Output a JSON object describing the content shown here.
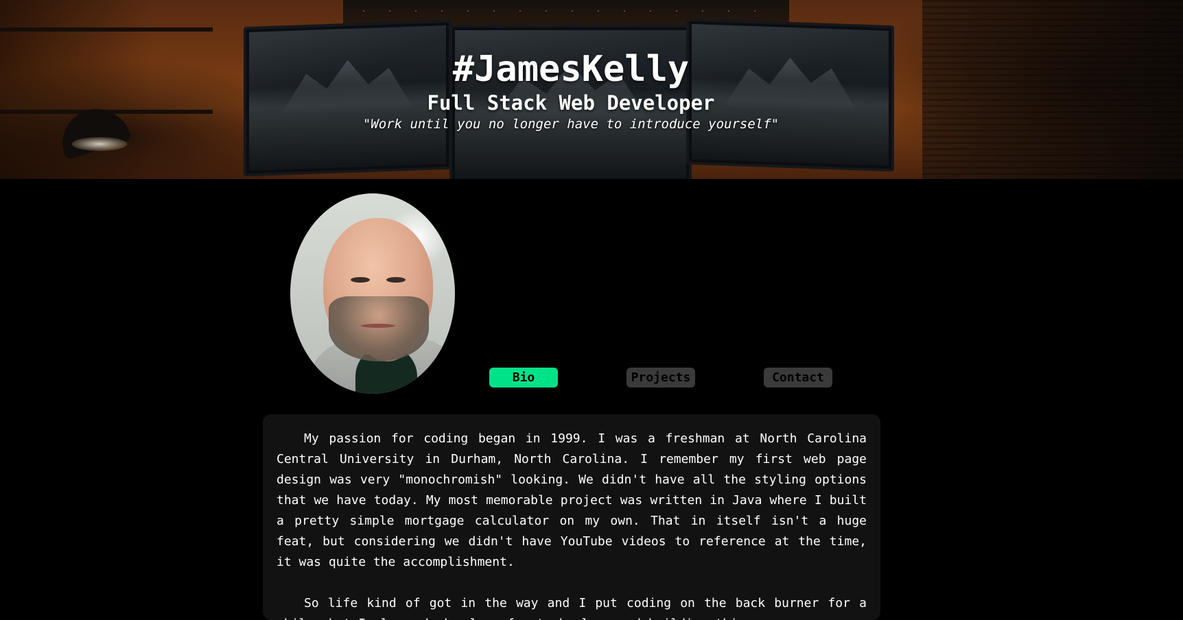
{
  "header": {
    "title": "#JamesKelly",
    "subtitle": "Full Stack Web Developer",
    "quote": "\"Work until you no longer have to introduce yourself\""
  },
  "profile": {
    "avatar_alt": "James Kelly"
  },
  "tabs": [
    {
      "label": "Bio",
      "active": true
    },
    {
      "label": "Projects",
      "active": false
    },
    {
      "label": "Contact",
      "active": false
    }
  ],
  "bio": {
    "paragraphs": [
      "My passion for coding began in 1999. I was a freshman at North Carolina Central University in Durham, North Carolina. I remember my first web page design was very \"monochromish\" looking. We didn't have all the styling options that we have today. My most memorable project was written in Java where I built a pretty simple mortgage calculator on my own. That in itself isn't a huge feat, but considering we didn't have YouTube videos to reference at the time, it was quite the accomplishment.",
      "So life kind of got in the way and I put coding on the back burner for a while, but I always had a love for technology and building things."
    ]
  },
  "colors": {
    "accent": "#00e288",
    "inactive_tab": "#3a3a3a",
    "card_bg": "#121212",
    "page_bg": "#000000"
  }
}
